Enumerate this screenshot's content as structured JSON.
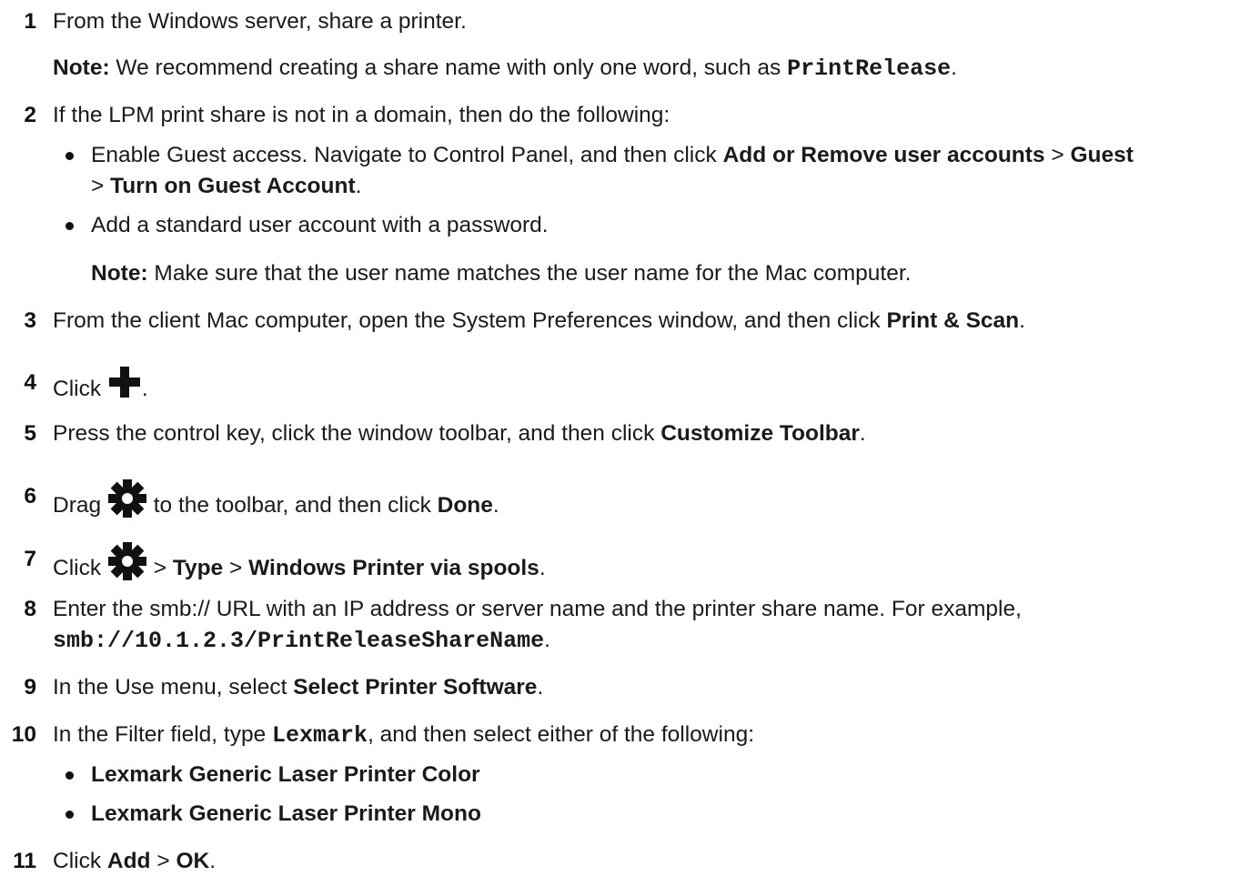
{
  "steps": [
    {
      "num": "1",
      "text": "From the Windows server, share a printer."
    },
    {
      "note_label": "Note:",
      "note_a": " We recommend creating a share name with only one word, such as ",
      "note_code": "PrintRelease",
      "note_b": "."
    },
    {
      "num": "2",
      "text": "If the LPM print share is not in a domain, then do the following:",
      "bullet1_a": "Enable Guest access. Navigate to Control Panel, and then click ",
      "bullet1_b1": "Add or Remove user accounts",
      "bullet1_sep": " > ",
      "bullet1_b2": "Guest",
      "bullet1_line2_sep": "> ",
      "bullet1_b3": "Turn on Guest Account",
      "bullet1_end": ".",
      "bullet2": "Add a standard user account with a password.",
      "note_label": "Note:",
      "note_text": " Make sure that the user name matches the user name for the Mac computer."
    },
    {
      "num": "3",
      "a": "From the client Mac computer, open the System Preferences window, and then click ",
      "b": "Print & Scan",
      "c": "."
    },
    {
      "num": "4",
      "a": "Click ",
      "icon": "plus-icon",
      "c": "."
    },
    {
      "num": "5",
      "a": "Press the control key, click the window toolbar, and then click ",
      "b": "Customize Toolbar",
      "c": "."
    },
    {
      "num": "6",
      "a": "Drag ",
      "icon": "gear-icon",
      "m": " to the toolbar, and then click ",
      "b": "Done",
      "c": "."
    },
    {
      "num": "7",
      "a": "Click ",
      "icon": "gear-icon",
      "sep1": " > ",
      "b1": "Type",
      "sep2": " > ",
      "b2": "Windows Printer via spools",
      "c": "."
    },
    {
      "num": "8",
      "a": "Enter the smb:// URL with an IP address or server name and the printer share name. For example,",
      "code": "smb://10.1.2.3/PrintReleaseShareName",
      "c": "."
    },
    {
      "num": "9",
      "a": "In the Use menu, select ",
      "b": "Select Printer Software",
      "c": "."
    },
    {
      "num": "10",
      "a": "In the Filter field, type ",
      "code": "Lexmark",
      "m": ", and then select either of the following:",
      "bullet1": "Lexmark Generic Laser Printer Color",
      "bullet2": "Lexmark Generic Laser Printer Mono"
    },
    {
      "num": "11",
      "a": "Click ",
      "b1": "Add",
      "sep": " > ",
      "b2": "OK",
      "c": "."
    }
  ]
}
